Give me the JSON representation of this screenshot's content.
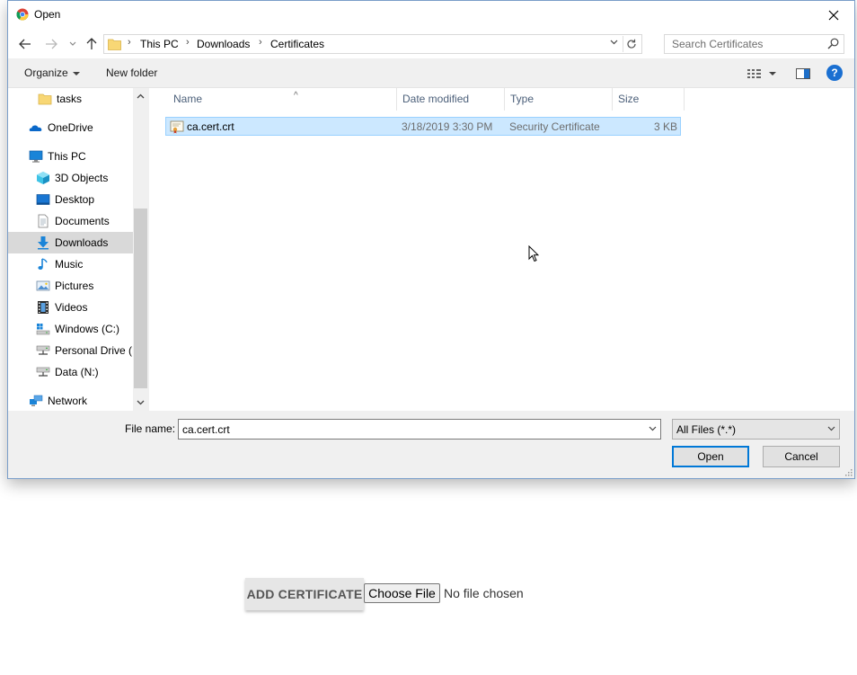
{
  "dialog": {
    "title": "Open",
    "breadcrumbs": [
      "This PC",
      "Downloads",
      "Certificates"
    ],
    "search_placeholder": "Search Certificates",
    "toolbar": {
      "organize": "Organize",
      "new_folder": "New folder",
      "help": "?"
    },
    "nav_items": [
      {
        "label": "tasks",
        "icon": "folder-icon",
        "selected": false
      },
      {
        "label": "OneDrive",
        "icon": "onedrive-icon",
        "selected": false
      },
      {
        "label": "This PC",
        "icon": "computer-icon",
        "selected": false
      },
      {
        "label": "3D Objects",
        "icon": "3d-objects-icon",
        "selected": false
      },
      {
        "label": "Desktop",
        "icon": "desktop-icon",
        "selected": false
      },
      {
        "label": "Documents",
        "icon": "documents-icon",
        "selected": false
      },
      {
        "label": "Downloads",
        "icon": "downloads-icon",
        "selected": true
      },
      {
        "label": "Music",
        "icon": "music-icon",
        "selected": false
      },
      {
        "label": "Pictures",
        "icon": "pictures-icon",
        "selected": false
      },
      {
        "label": "Videos",
        "icon": "videos-icon",
        "selected": false
      },
      {
        "label": "Windows (C:)",
        "icon": "drive-icon",
        "selected": false
      },
      {
        "label": "Personal Drive (N",
        "icon": "network-drive-icon",
        "selected": false
      },
      {
        "label": "Data (N:)",
        "icon": "network-drive-icon",
        "selected": false
      },
      {
        "label": "Network",
        "icon": "network-icon",
        "selected": false
      }
    ],
    "columns": [
      "Name",
      "Date modified",
      "Type",
      "Size"
    ],
    "files": [
      {
        "name": "ca.cert.crt",
        "date": "3/18/2019 3:30 PM",
        "type": "Security Certificate",
        "size": "3 KB",
        "selected": true
      }
    ],
    "file_name_label": "File name:",
    "file_name_value": "ca.cert.crt",
    "file_type": "All Files (*.*)",
    "open_button": "Open",
    "cancel_button": "Cancel"
  },
  "page": {
    "add_certificate": "ADD CERTIFICATE",
    "choose_file": "Choose File",
    "no_file": "No file chosen"
  },
  "colors": {
    "selection_bg": "#cce8ff",
    "selection_border": "#99d1ff",
    "nav_selected_bg": "#d9d9d9",
    "accent": "#0078d7"
  }
}
